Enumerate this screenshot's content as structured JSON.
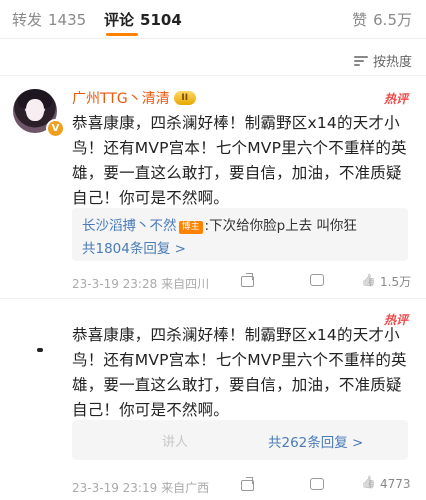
{
  "tabs": {
    "repost": {
      "label": "转发",
      "count": "1435"
    },
    "comment": {
      "label": "评论",
      "count": "5104"
    },
    "like": {
      "label": "赞",
      "count": "6.5万"
    }
  },
  "sort": {
    "label": "按热度"
  },
  "comments": [
    {
      "username": "广州TTG丶清清",
      "level_badge": "II",
      "hot_tag": "热评",
      "text": "恭喜康康，四杀澜好棒！制霸野区x14的天才小鸟！还有MVP宫本！七个MVP里六个不重样的英雄，要一直这么敢打，要自信，加油，不准质疑自己！你可是不然啊。",
      "reply": {
        "user": "长沙滔搏丶不然",
        "op_tag": "博主",
        "text": ":下次给你脸p上去 叫你狂"
      },
      "reply_count": "共1804条回复 >",
      "date": "23-3-19 23:28",
      "location": "来自四川",
      "likes": "1.5万"
    },
    {
      "username": "",
      "hot_tag": "热评",
      "text": "恭喜康康，四杀澜好棒！制霸野区x14的天才小鸟！还有MVP宫本！七个MVP里六个不重样的英雄，要一直这么敢打，要自信，加油，不准质疑自己！你可是不然啊。",
      "reply_faded": "讲人",
      "reply_count": "共262条回复 >",
      "date": "23-3-19 23:19",
      "location": "来自广西",
      "likes": "4773"
    }
  ],
  "icons": [
    "sort-icon",
    "verified-icon",
    "share-icon",
    "comment-icon",
    "like-icon"
  ],
  "colors": {
    "accent": "#ff8200",
    "username": "#e8590c",
    "link": "#4a7bb7",
    "hot": "#f04a4a"
  }
}
